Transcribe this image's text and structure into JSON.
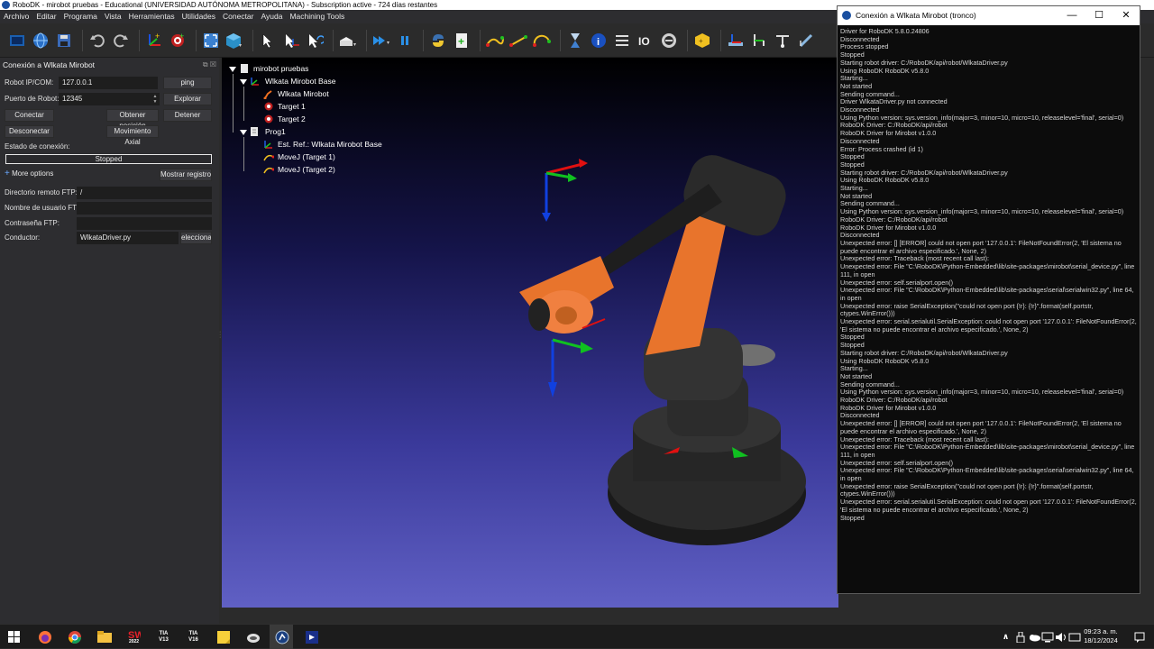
{
  "window": {
    "title": "RoboDK - mirobot pruebas - Educational (UNIVERSIDAD AUTÓNOMA METROPOLITANA) - Subscription active - 724 días restantes"
  },
  "menu": {
    "items": [
      "Archivo",
      "Editar",
      "Programa",
      "Vista",
      "Herramientas",
      "Utilidades",
      "Conectar",
      "Ayuda",
      "Machining Tools"
    ]
  },
  "toolbar": {
    "icons": [
      "new-station-icon",
      "open-globe-icon",
      "save-icon",
      "undo-icon",
      "redo-icon",
      "add-reference-frame-icon",
      "add-target-icon",
      "fit-all-icon",
      "view-cube-icon",
      "select-icon",
      "move-reference-icon",
      "move-tool-icon",
      "add-object-icon",
      "run-program-icon",
      "pause-icon",
      "python-icon",
      "add-program-icon",
      "movej-icon",
      "movel-icon",
      "movec-icon",
      "wait-icon",
      "info-icon",
      "list-icon",
      "io-icon",
      "program-call-icon",
      "ik-icon",
      "ref-frame-icon",
      "tool-frame-icon",
      "target-frame-icon",
      "ruler-icon"
    ]
  },
  "panel": {
    "title": "Conexión a Wlkata Mirobot",
    "header_buttons": "⧉ ☒",
    "ip_label": "Robot IP/COM:",
    "ip_value": "127.0.0.1",
    "ping_label": "ping",
    "port_label": "Puerto de Robot:",
    "port_value": "12345",
    "explore_label": "Explorar",
    "connect_label": "Conectar",
    "get_position_label": "Obtener posición",
    "stop_label": "Detener",
    "disconnect_label": "Desconectar",
    "axial_move_label": "Movimiento Axial",
    "conn_state_label": "Estado de conexión:",
    "status_value": "Stopped",
    "more_options_label": "More options",
    "show_log_label": "Mostrar registro",
    "ftp_dir_label": "Directorio remoto FTP:",
    "ftp_dir_value": "/",
    "ftp_user_label": "Nombre de usuario FTP:",
    "ftp_user_value": "",
    "ftp_pass_label": "Contraseña FTP:",
    "ftp_pass_value": "",
    "driver_label": "Conductor:",
    "driver_value": "WlkataDriver.py",
    "select_label": "eleccionar"
  },
  "tree": {
    "station": "mirobot pruebas",
    "base": "Wlkata Mirobot Base",
    "robot": "Wlkata Mirobot",
    "target1": "Target 1",
    "target2": "Target 2",
    "prog": "Prog1",
    "ref_instr": "Est. Ref.: Wlkata Mirobot Base",
    "move1": "MoveJ (Target 1)",
    "move2": "MoveJ (Target 2)"
  },
  "console": {
    "title": "Conexión a Wlkata Mirobot (tronco)",
    "lines": [
      "Driver for RoboDK 5.8.0.24806",
      "Disconnected",
      "Process stopped",
      "Stopped",
      "Starting robot driver: C:/RoboDK/api/robot/WlkataDriver.py",
      "Using RoboDK RoboDK v5.8.0",
      "Starting...",
      "Not started",
      "Sending command...",
      "Driver WlkataDriver.py not connected",
      "Disconnected",
      "Using Python version: sys.version_info(major=3, minor=10, micro=10, releaselevel='final', serial=0)",
      "RoboDK Driver: C:/RoboDK/api/robot",
      "RoboDK Driver for Mirobot v1.0.0",
      "Disconnected",
      "Error: Process crashed (id 1)",
      "Stopped",
      "Stopped",
      "Starting robot driver: C:/RoboDK/api/robot/WlkataDriver.py",
      "Using RoboDK RoboDK v5.8.0",
      "Starting...",
      "Not started",
      "Sending command...",
      "Using Python version: sys.version_info(major=3, minor=10, micro=10, releaselevel='final', serial=0)",
      "RoboDK Driver: C:/RoboDK/api/robot",
      "RoboDK Driver for Mirobot v1.0.0",
      "Disconnected",
      "Unexpected error: [] [ERROR] could not open port '127.0.0.1': FileNotFoundError(2, 'El sistema no puede encontrar el archivo especificado.', None, 2)",
      "Unexpected error: Traceback (most recent call last):",
      "Unexpected error: File \"C:\\RoboDK\\Python-Embedded\\lib\\site-packages\\mirobot\\serial_device.py\", line 111, in open",
      "Unexpected error: self.serialport.open()",
      "Unexpected error: File \"C:\\RoboDK\\Python-Embedded\\lib\\site-packages\\serial\\serialwin32.py\", line 64, in open",
      "Unexpected error: raise SerialException(\"could not open port {!r}: {!r}\".format(self.portstr, ctypes.WinError()))",
      "Unexpected error: serial.serialutil.SerialException: could not open port '127.0.0.1': FileNotFoundError(2, 'El sistema no puede encontrar el archivo especificado.', None, 2)",
      "Stopped",
      "Stopped",
      "Starting robot driver: C:/RoboDK/api/robot/WlkataDriver.py",
      "Using RoboDK RoboDK v5.8.0",
      "Starting...",
      "Not started",
      "Sending command...",
      "Using Python version: sys.version_info(major=3, minor=10, micro=10, releaselevel='final', serial=0)",
      "RoboDK Driver: C:/RoboDK/api/robot",
      "RoboDK Driver for Mirobot v1.0.0",
      "Disconnected",
      "Unexpected error: [] [ERROR] could not open port '127.0.0.1': FileNotFoundError(2, 'El sistema no puede encontrar el archivo especificado.', None, 2)",
      "Unexpected error: Traceback (most recent call last):",
      "Unexpected error: File \"C:\\RoboDK\\Python-Embedded\\lib\\site-packages\\mirobot\\serial_device.py\", line 111, in open",
      "Unexpected error: self.serialport.open()",
      "Unexpected error: File \"C:\\RoboDK\\Python-Embedded\\lib\\site-packages\\serial\\serialwin32.py\", line 64, in open",
      "Unexpected error: raise SerialException(\"could not open port {!r}: {!r}\".format(self.portstr, ctypes.WinError()))",
      "Unexpected error: serial.serialutil.SerialException: could not open port '127.0.0.1': FileNotFoundError(2, 'El sistema no puede encontrar el archivo especificado.', None, 2)",
      "Stopped"
    ]
  },
  "taskbar": {
    "apps": [
      "windows-start-icon",
      "firefox-icon",
      "chrome-icon",
      "file-explorer-icon",
      "solidworks-icon",
      "tia-portal-v13-icon",
      "tia-portal-v16-icon",
      "sticky-notes-icon",
      "app-icon",
      "robodk-icon",
      "visual-studio-icon"
    ],
    "sw_label": "2022",
    "tia13_label": "V13",
    "tia16_label": "V16",
    "tia_text": "TIA",
    "time": "09:23 a. m.",
    "date": "18/12/2024"
  },
  "colors": {
    "accent": "#f07020",
    "robot_dark": "#2a2a2a",
    "axis_red": "#e01010",
    "axis_green": "#10c020",
    "axis_blue": "#1040e0"
  }
}
